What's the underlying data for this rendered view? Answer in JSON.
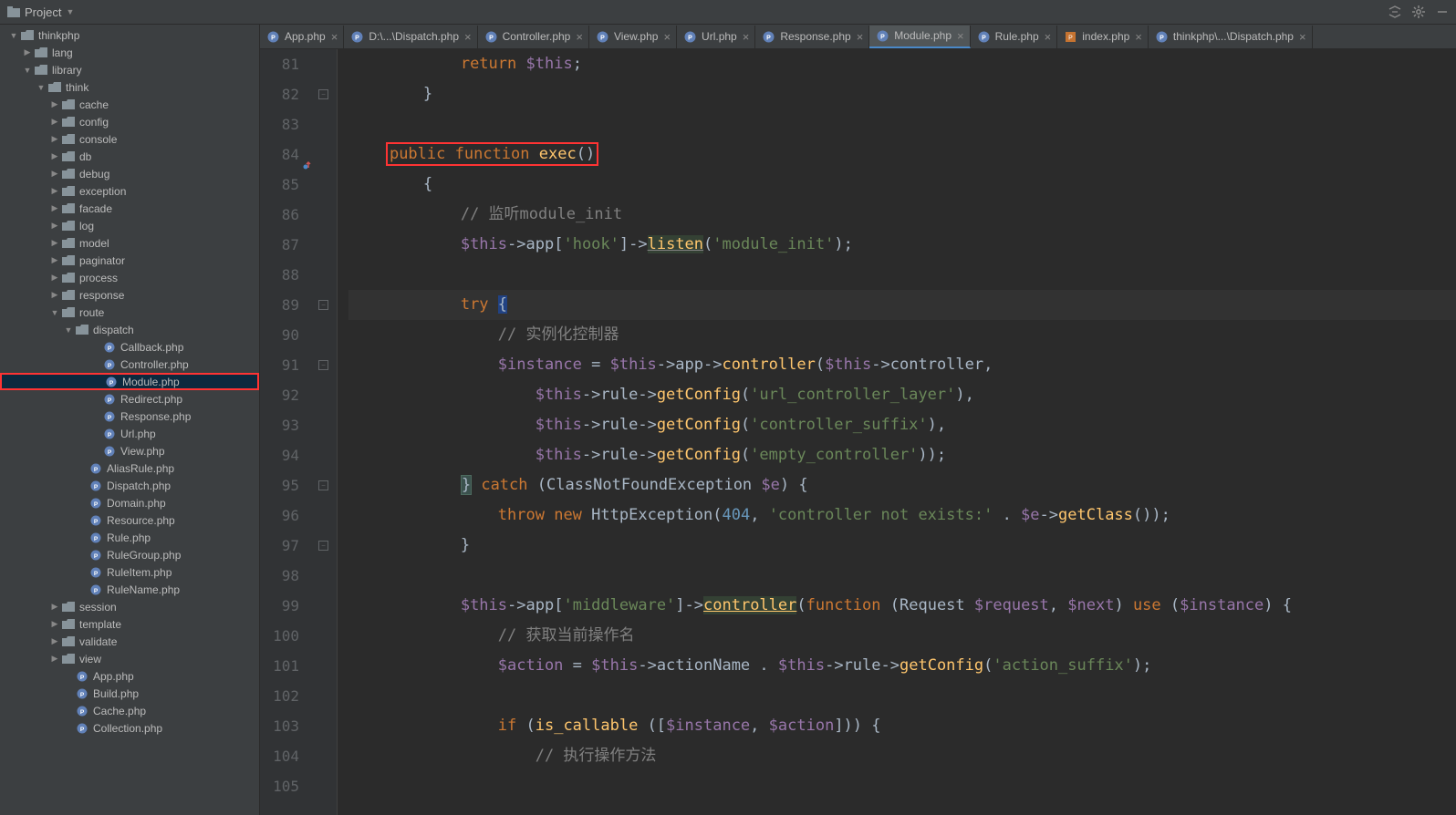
{
  "toolbar": {
    "project_label": "Project"
  },
  "tabs": [
    {
      "label": "App.php",
      "type": "php"
    },
    {
      "label": "D:\\...\\Dispatch.php",
      "type": "php"
    },
    {
      "label": "Controller.php",
      "type": "php"
    },
    {
      "label": "View.php",
      "type": "php"
    },
    {
      "label": "Url.php",
      "type": "php"
    },
    {
      "label": "Response.php",
      "type": "php"
    },
    {
      "label": "Module.php",
      "type": "php",
      "active": true
    },
    {
      "label": "Rule.php",
      "type": "php"
    },
    {
      "label": "index.php",
      "type": "php2"
    },
    {
      "label": "thinkphp\\...\\Dispatch.php",
      "type": "php"
    }
  ],
  "tree": {
    "root": "thinkphp",
    "items": [
      "lang",
      "library",
      "think",
      "cache",
      "config",
      "console",
      "db",
      "debug",
      "exception",
      "facade",
      "log",
      "model",
      "paginator",
      "process",
      "response",
      "route",
      "dispatch"
    ],
    "dispatch_files": [
      "Callback.php",
      "Controller.php",
      "Module.php",
      "Redirect.php",
      "Response.php",
      "Url.php",
      "View.php"
    ],
    "route_files": [
      "AliasRule.php",
      "Dispatch.php",
      "Domain.php",
      "Resource.php",
      "Rule.php",
      "RuleGroup.php",
      "RuleItem.php",
      "RuleName.php"
    ],
    "think_more": [
      "session",
      "template",
      "validate",
      "view"
    ],
    "think_files": [
      "App.php",
      "Build.php",
      "Cache.php",
      "Collection.php"
    ]
  },
  "code": {
    "lines": [
      {
        "n": 81,
        "text_parts": [
          [
            "            ",
            ""
          ],
          [
            "return",
            "kw"
          ],
          [
            " ",
            ""
          ],
          [
            "$this",
            "var"
          ],
          [
            ";",
            ""
          ]
        ]
      },
      {
        "n": 82,
        "text_parts": [
          [
            "        }",
            ""
          ]
        ],
        "fold": true
      },
      {
        "n": 83,
        "text_parts": [
          [
            "",
            ""
          ]
        ]
      },
      {
        "n": 84,
        "text_parts": [
          [
            "    ",
            ""
          ],
          [
            "boxstart",
            ""
          ],
          [
            "public",
            "kw"
          ],
          [
            " ",
            ""
          ],
          [
            "function",
            "kw"
          ],
          [
            " ",
            ""
          ],
          [
            "exec",
            "fn"
          ],
          [
            "()",
            ""
          ],
          [
            "boxend",
            ""
          ]
        ],
        "override_marker": true
      },
      {
        "n": 85,
        "text_parts": [
          [
            "        {",
            ""
          ]
        ]
      },
      {
        "n": 86,
        "text_parts": [
          [
            "            ",
            ""
          ],
          [
            "// 监听module_init",
            "comment"
          ]
        ]
      },
      {
        "n": 87,
        "text_parts": [
          [
            "            ",
            ""
          ],
          [
            "$this",
            "var"
          ],
          [
            "->",
            ""
          ],
          [
            "app",
            "ident"
          ],
          [
            "[",
            ""
          ],
          [
            "'hook'",
            "str"
          ],
          [
            "]->",
            ""
          ],
          [
            "listen",
            "underline fn"
          ],
          [
            "(",
            ""
          ],
          [
            "'module_init'",
            "str"
          ],
          [
            ");",
            ""
          ]
        ]
      },
      {
        "n": 88,
        "text_parts": [
          [
            "",
            ""
          ]
        ]
      },
      {
        "n": 89,
        "highlight": true,
        "fold": true,
        "text_parts": [
          [
            "            ",
            ""
          ],
          [
            "try",
            "kw"
          ],
          [
            " ",
            ""
          ],
          [
            "{",
            "caret-bg"
          ]
        ]
      },
      {
        "n": 90,
        "text_parts": [
          [
            "                ",
            ""
          ],
          [
            "// 实例化控制器",
            "comment"
          ]
        ]
      },
      {
        "n": 91,
        "fold": true,
        "text_parts": [
          [
            "                ",
            ""
          ],
          [
            "$instance",
            "var"
          ],
          [
            " = ",
            ""
          ],
          [
            "$this",
            "var"
          ],
          [
            "->",
            ""
          ],
          [
            "app",
            "ident"
          ],
          [
            "->",
            ""
          ],
          [
            "controller",
            "fn"
          ],
          [
            "(",
            ""
          ],
          [
            "$this",
            "var"
          ],
          [
            "->",
            ""
          ],
          [
            "controller",
            "ident"
          ],
          [
            ",",
            ""
          ]
        ]
      },
      {
        "n": 92,
        "text_parts": [
          [
            "                    ",
            ""
          ],
          [
            "$this",
            "var"
          ],
          [
            "->",
            ""
          ],
          [
            "rule",
            "ident"
          ],
          [
            "->",
            ""
          ],
          [
            "getConfig",
            "fn"
          ],
          [
            "(",
            ""
          ],
          [
            "'url_controller_layer'",
            "str"
          ],
          [
            "),",
            ""
          ]
        ]
      },
      {
        "n": 93,
        "text_parts": [
          [
            "                    ",
            ""
          ],
          [
            "$this",
            "var"
          ],
          [
            "->",
            ""
          ],
          [
            "rule",
            "ident"
          ],
          [
            "->",
            ""
          ],
          [
            "getConfig",
            "fn"
          ],
          [
            "(",
            ""
          ],
          [
            "'controller_suffix'",
            "str"
          ],
          [
            "),",
            ""
          ]
        ]
      },
      {
        "n": 94,
        "text_parts": [
          [
            "                    ",
            ""
          ],
          [
            "$this",
            "var"
          ],
          [
            "->",
            ""
          ],
          [
            "rule",
            "ident"
          ],
          [
            "->",
            ""
          ],
          [
            "getConfig",
            "fn"
          ],
          [
            "(",
            ""
          ],
          [
            "'empty_controller'",
            "str"
          ],
          [
            "));",
            ""
          ]
        ]
      },
      {
        "n": 95,
        "fold": true,
        "text_parts": [
          [
            "            ",
            ""
          ],
          [
            "}",
            "brace-match"
          ],
          [
            " ",
            ""
          ],
          [
            "catch",
            "kw"
          ],
          [
            " (",
            ""
          ],
          [
            "ClassNotFoundException ",
            "ident"
          ],
          [
            "$e",
            "var"
          ],
          [
            ") {",
            ""
          ]
        ]
      },
      {
        "n": 96,
        "text_parts": [
          [
            "                ",
            ""
          ],
          [
            "throw",
            "kw"
          ],
          [
            " ",
            ""
          ],
          [
            "new",
            "kw"
          ],
          [
            " ",
            ""
          ],
          [
            "HttpException",
            "ident"
          ],
          [
            "(",
            ""
          ],
          [
            "404",
            "num"
          ],
          [
            ", ",
            ""
          ],
          [
            "'controller not exists:'",
            "str"
          ],
          [
            " . ",
            ""
          ],
          [
            "$e",
            "var"
          ],
          [
            "->",
            ""
          ],
          [
            "getClass",
            "fn"
          ],
          [
            "());",
            ""
          ]
        ]
      },
      {
        "n": 97,
        "fold": true,
        "text_parts": [
          [
            "            }",
            ""
          ]
        ]
      },
      {
        "n": 98,
        "text_parts": [
          [
            "",
            ""
          ]
        ]
      },
      {
        "n": 99,
        "text_parts": [
          [
            "            ",
            ""
          ],
          [
            "$this",
            "var"
          ],
          [
            "->",
            ""
          ],
          [
            "app",
            "ident"
          ],
          [
            "[",
            ""
          ],
          [
            "'middleware'",
            "str"
          ],
          [
            "]->",
            ""
          ],
          [
            "controller",
            "underline2 fn"
          ],
          [
            "(",
            ""
          ],
          [
            "function ",
            "kw"
          ],
          [
            "(",
            ""
          ],
          [
            "Request ",
            "ident"
          ],
          [
            "$request",
            "var"
          ],
          [
            ", ",
            ""
          ],
          [
            "$next",
            "var"
          ],
          [
            ") ",
            ""
          ],
          [
            "use ",
            "kw"
          ],
          [
            "(",
            ""
          ],
          [
            "$instance",
            "var"
          ],
          [
            ") {",
            ""
          ]
        ]
      },
      {
        "n": 100,
        "text_parts": [
          [
            "                ",
            ""
          ],
          [
            "// 获取当前操作名",
            "comment"
          ]
        ]
      },
      {
        "n": 101,
        "text_parts": [
          [
            "                ",
            ""
          ],
          [
            "$action",
            "var"
          ],
          [
            " = ",
            ""
          ],
          [
            "$this",
            "var"
          ],
          [
            "->",
            ""
          ],
          [
            "actionName",
            "ident"
          ],
          [
            " . ",
            ""
          ],
          [
            "$this",
            "var"
          ],
          [
            "->",
            ""
          ],
          [
            "rule",
            "ident"
          ],
          [
            "->",
            ""
          ],
          [
            "getConfig",
            "fn"
          ],
          [
            "(",
            ""
          ],
          [
            "'action_suffix'",
            "str"
          ],
          [
            ");",
            ""
          ]
        ]
      },
      {
        "n": 102,
        "text_parts": [
          [
            "",
            ""
          ]
        ]
      },
      {
        "n": 103,
        "text_parts": [
          [
            "                ",
            ""
          ],
          [
            "if ",
            "kw"
          ],
          [
            "(",
            ""
          ],
          [
            "is_callable",
            "fn"
          ],
          [
            " ([",
            ""
          ],
          [
            "$instance",
            "var"
          ],
          [
            ", ",
            ""
          ],
          [
            "$action",
            "var"
          ],
          [
            "])) {",
            ""
          ]
        ]
      },
      {
        "n": 104,
        "text_parts": [
          [
            "                    ",
            ""
          ],
          [
            "// 执行操作方法",
            "comment"
          ]
        ]
      },
      {
        "n": 105,
        "text_parts": [
          [
            "",
            ""
          ]
        ]
      }
    ]
  }
}
